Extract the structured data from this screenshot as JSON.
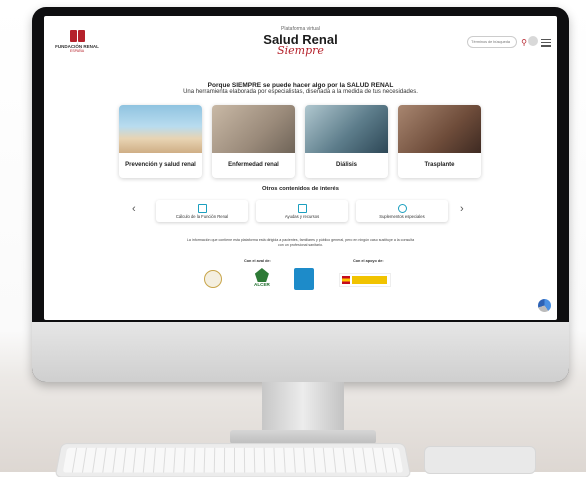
{
  "logo": {
    "name": "FUNDACIÓN RENAL",
    "country": "ESPAÑA"
  },
  "brand": {
    "platform": "Plataforma virtual",
    "title": "Salud Renal",
    "script": "Siempre"
  },
  "search": {
    "placeholder": "Términos de búsqueda"
  },
  "intro": {
    "headline": "Porque SIEMPRE se puede hacer algo por la SALUD RENAL",
    "subline": "Una herramienta elaborada por especialistas, diseñada a la medida de tus necesidades."
  },
  "cards": [
    {
      "label": "Prevención y salud renal"
    },
    {
      "label": "Enfermedad renal"
    },
    {
      "label": "Diálisis"
    },
    {
      "label": "Trasplante"
    }
  ],
  "otros": {
    "title": "Otros contenidos de interés",
    "links": [
      {
        "label": "Cálculo de la Función Renal"
      },
      {
        "label": "Ayudas y recursos"
      },
      {
        "label": "Suplementos especiales"
      }
    ]
  },
  "info": "La información que contiene esta plataforma está dirigida a pacientes, familiares y público general, pero en ningún caso sustituye a la consulta con un profesional sanitario.",
  "partners": {
    "aval_title": "Con el aval de:",
    "apoyo_title": "Con el apoyo de:",
    "alcer": {
      "name": "ALCER"
    }
  },
  "colors": {
    "accent": "#b5212b",
    "link_icon": "#1b9fbf"
  }
}
